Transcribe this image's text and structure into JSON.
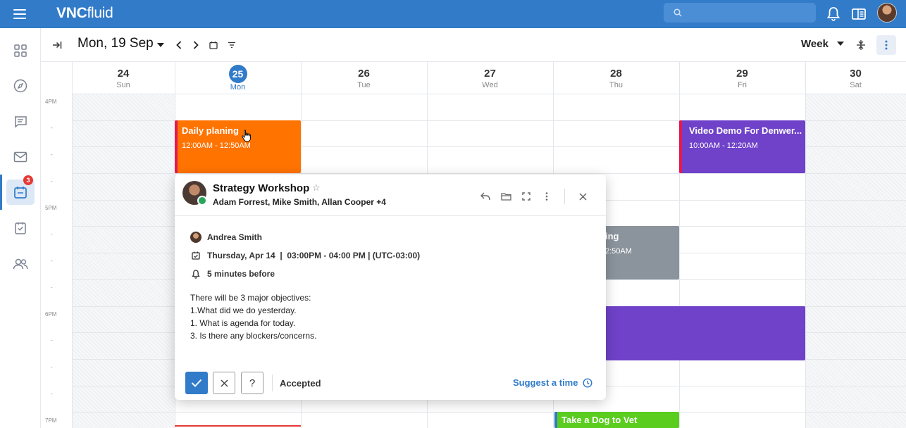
{
  "app": {
    "logo_bold": "VNC",
    "logo_light": "fluid",
    "search_placeholder": "",
    "colors": {
      "brand": "#317bc9",
      "orange": "#ff7300",
      "purple": "#6f42c9",
      "gray": "#8b949c",
      "green": "#5acd1f",
      "red": "#e53935"
    }
  },
  "leftnav": {
    "items": [
      {
        "name": "apps",
        "icon": "grid-icon"
      },
      {
        "name": "explore",
        "icon": "compass-icon"
      },
      {
        "name": "chat",
        "icon": "chat-icon"
      },
      {
        "name": "mail",
        "icon": "mail-icon"
      },
      {
        "name": "calendar",
        "icon": "calendar-icon",
        "active": true,
        "badge": "3"
      },
      {
        "name": "tasks",
        "icon": "task-icon"
      },
      {
        "name": "contacts",
        "icon": "people-icon"
      }
    ]
  },
  "toolbar": {
    "date_title": "Mon, 19 Sep",
    "view": "Week"
  },
  "calendar": {
    "days": [
      {
        "num": "24",
        "name": "Sun",
        "weekend": true
      },
      {
        "num": "25",
        "name": "Mon",
        "today": true
      },
      {
        "num": "26",
        "name": "Tue"
      },
      {
        "num": "27",
        "name": "Wed"
      },
      {
        "num": "28",
        "name": "Thu"
      },
      {
        "num": "29",
        "name": "Fri"
      },
      {
        "num": "30",
        "name": "Sat",
        "weekend": true
      }
    ],
    "time_labels": [
      "4PM",
      "-",
      "-",
      "-",
      "5PM",
      "-",
      "-",
      "-",
      "6PM",
      "-",
      "-",
      "-",
      "7PM"
    ],
    "events": {
      "daily": {
        "title": "Daily planing",
        "time": "12:00AM - 12:50AM"
      },
      "video": {
        "title": "Video Demo For Denwer...",
        "time": "10:00AM - 12:20AM"
      },
      "thursday_partial": {
        "title": "ing",
        "time": "2:50AM"
      },
      "vet": {
        "title": "Take a Dog to Vet"
      }
    }
  },
  "popup": {
    "title": "Strategy Workshop",
    "attendees": "Adam Forrest, Mike Smith, Allan Cooper +4",
    "organizer": "Andrea Smith",
    "when": "Thursday, Apr 14  |  03:00PM - 04:00 PM | (UTC-03:00)",
    "reminder": "5 minutes before",
    "description": [
      "There will be 3 major objectives:",
      "1.What did we do yesterday.",
      "1. What is agenda for today.",
      "3. Is there any blockers/concerns."
    ],
    "maybe_label": "?",
    "status": "Accepted",
    "suggest_label": "Suggest a time"
  }
}
